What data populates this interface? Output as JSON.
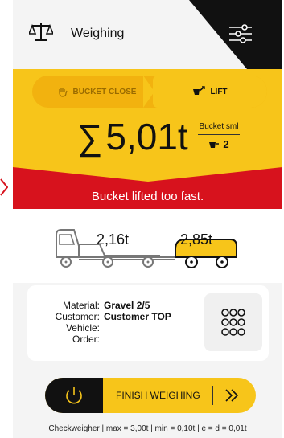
{
  "header": {
    "title": "Weighing",
    "icons": {
      "scale": "scale-icon",
      "menu": "sliders-menu-icon"
    }
  },
  "mode_toggle": {
    "left_label": "BUCKET CLOSE",
    "right_label": "LIFT",
    "selected": "LIFT"
  },
  "summary": {
    "sigma": "∑",
    "total": "5,01t",
    "bucket_label": "Bucket sml",
    "bucket_count": "2"
  },
  "warning": {
    "message": "Bucket lifted too fast."
  },
  "vehicles": {
    "truck_weight": "2,16t",
    "trailer_weight": "2,85t"
  },
  "info": {
    "labels": [
      "Material:",
      "Customer:",
      "Vehicle:",
      "Order:"
    ],
    "values": [
      "Gravel 2/5",
      "Customer TOP",
      "",
      ""
    ]
  },
  "actions": {
    "finish_label": "FINISH WEIGHING"
  },
  "footer": {
    "text": "Checkweigher | max = 3,00t | min = 0,10t | e = d = 0,01t"
  },
  "colors": {
    "yellow": "#f7c51a",
    "red": "#d7121d",
    "dark": "#111111"
  }
}
